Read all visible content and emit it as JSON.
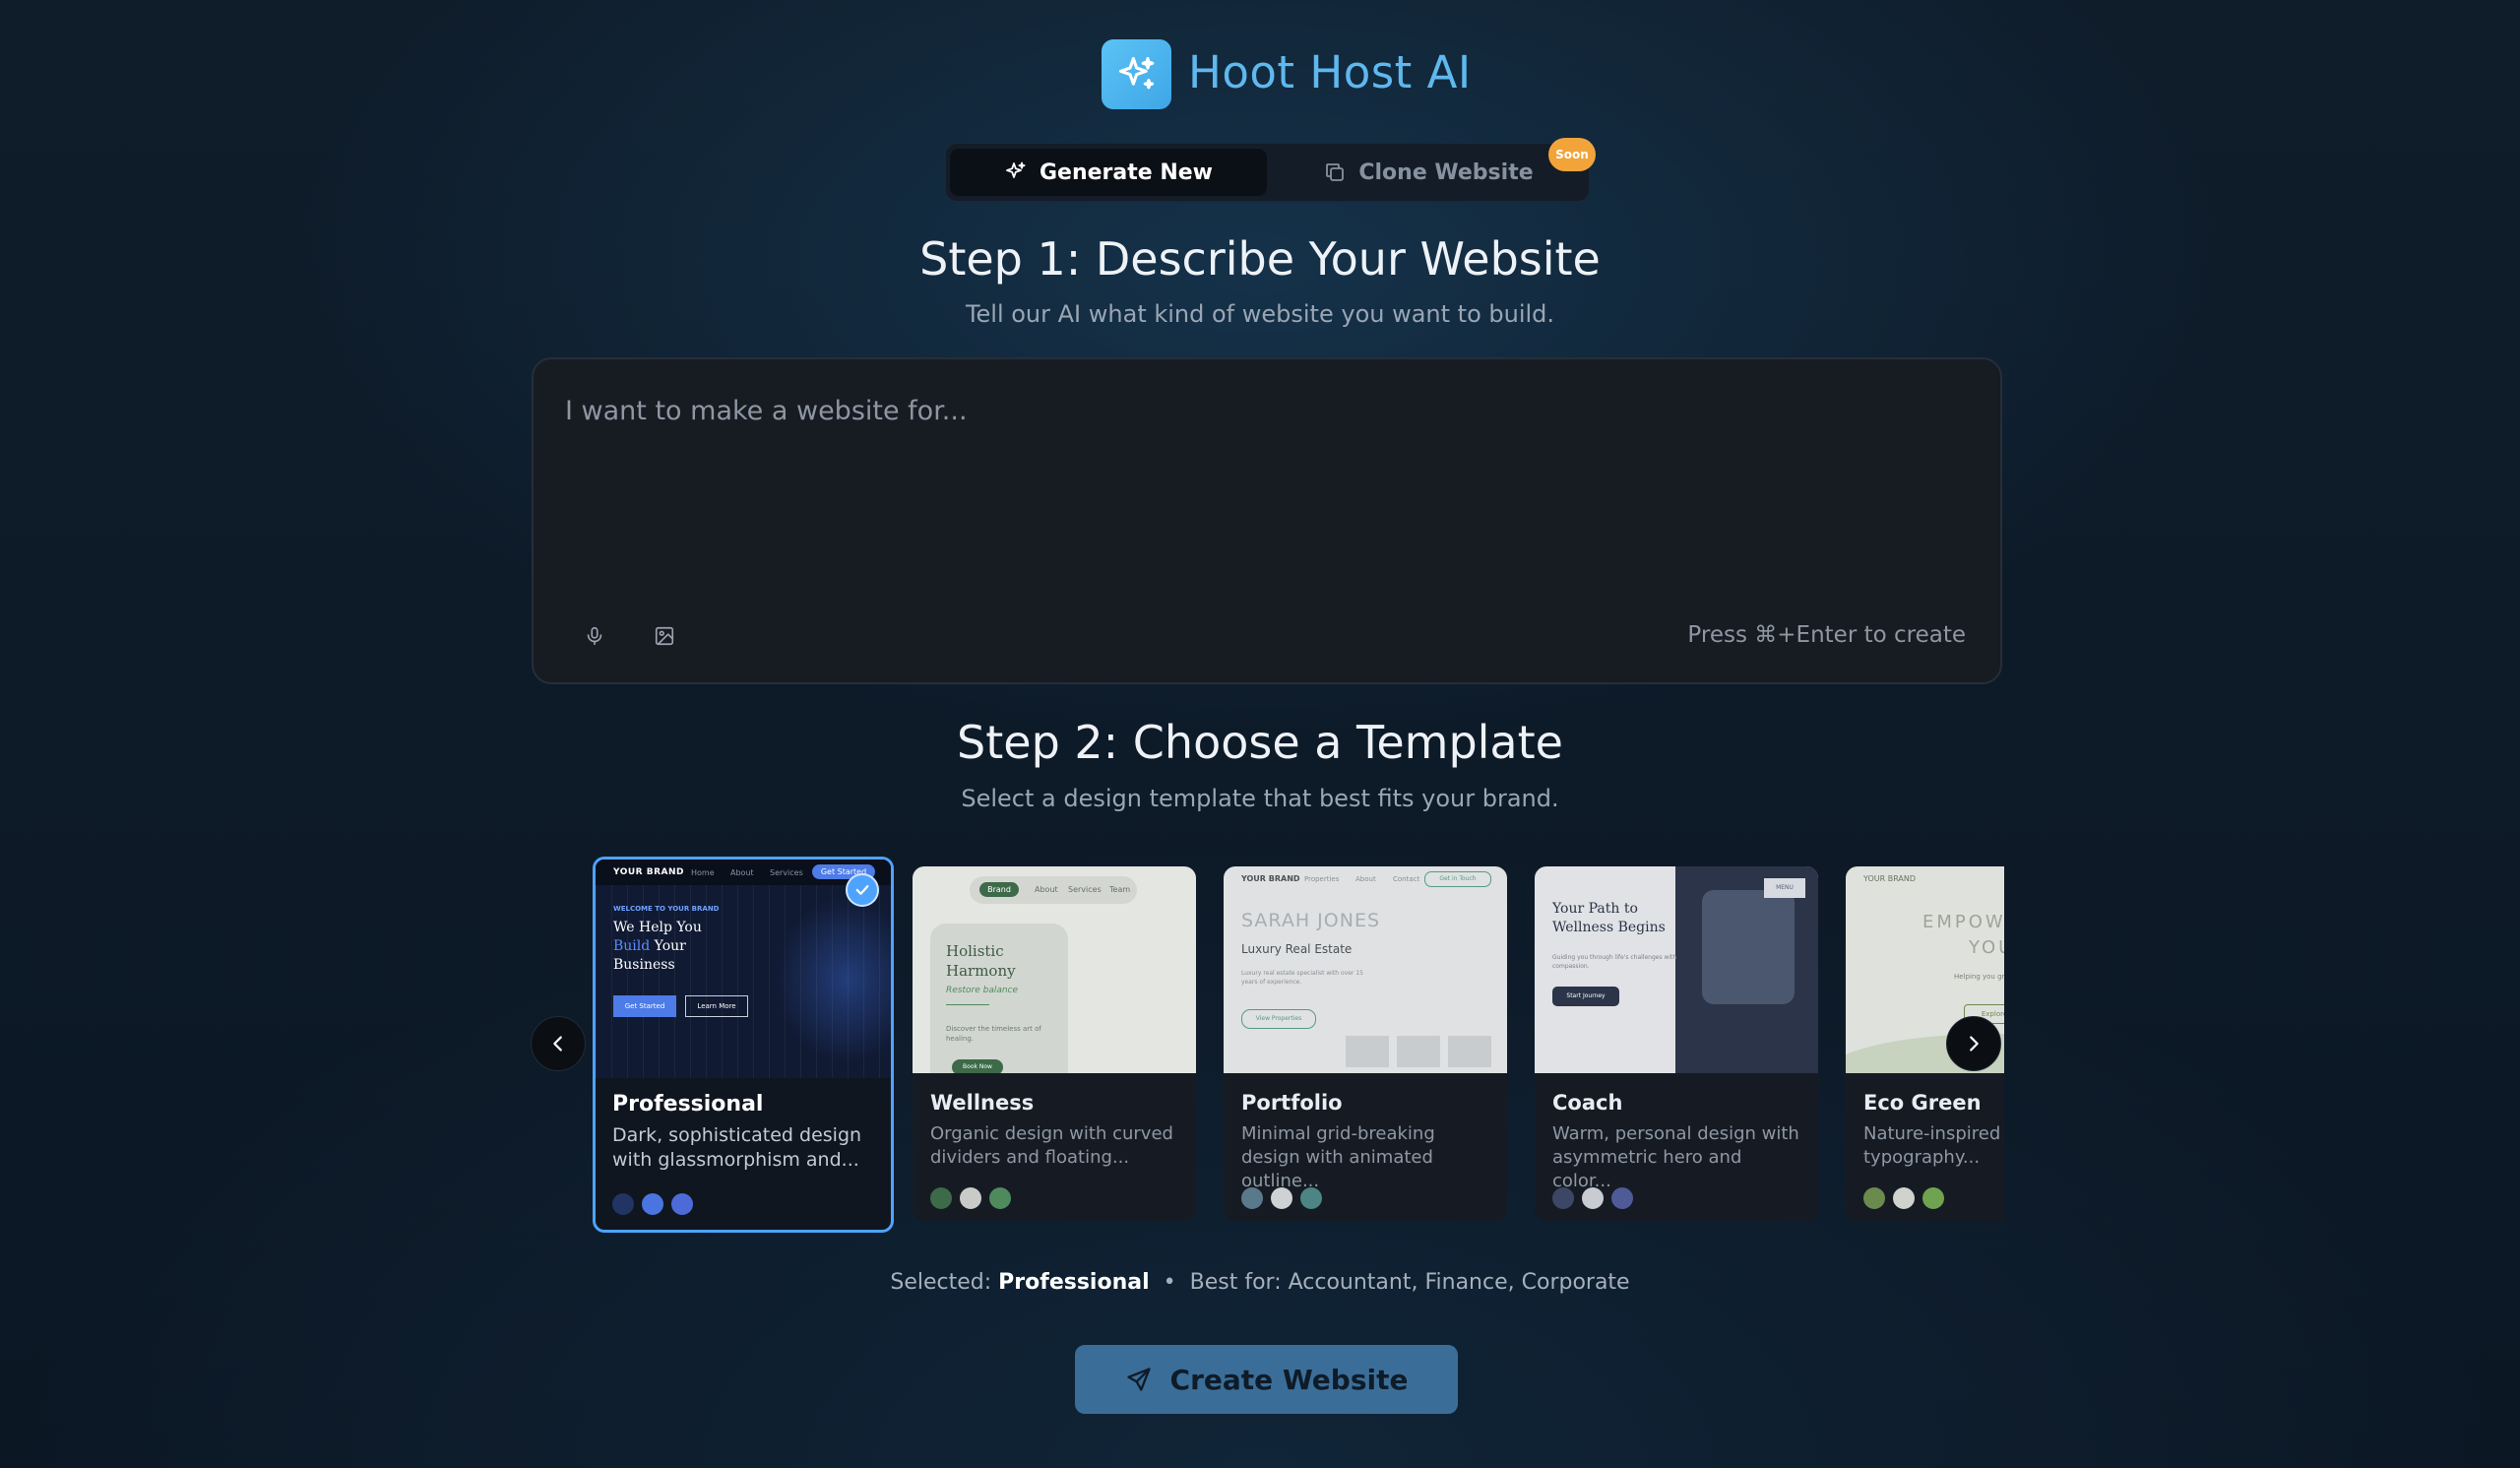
{
  "header": {
    "brand": "Hoot Host AI"
  },
  "tabs": [
    {
      "label": "Generate New",
      "active": true
    },
    {
      "label": "Clone Website",
      "active": false,
      "badge": "Soon"
    }
  ],
  "step1": {
    "title": "Step 1: Describe Your Website",
    "subtitle": "Tell our AI what kind of website you want to build.",
    "placeholder": "I want to make a website for...",
    "hint": "Press ⌘+Enter to create"
  },
  "step2": {
    "title": "Step 2: Choose a Template",
    "subtitle": "Select a design template that best fits your brand."
  },
  "templates": [
    {
      "name": "Professional",
      "description": "Dark, sophisticated design with glassmorphism and...",
      "colors": [
        "#223463",
        "#4a74e0",
        "#4d6bd8"
      ],
      "selected": true,
      "preview": {
        "brand": "YOUR BRAND",
        "nav": [
          "Home",
          "About",
          "Services"
        ],
        "cta": "Get Started",
        "eyebrow": "WELCOME TO YOUR BRAND",
        "headline1": "We Help You",
        "headline2_accent": "Build",
        "headline2_rest": " Your",
        "headline3": "Business",
        "primary": "Get Started",
        "secondary": "Learn More"
      }
    },
    {
      "name": "Wellness",
      "description": "Organic design with curved dividers and floating...",
      "colors": [
        "#3d6a48",
        "#c9cbc9",
        "#4f8a5d"
      ],
      "selected": false,
      "preview": {
        "nav": [
          "Brand",
          "About",
          "Services",
          "Team"
        ],
        "title1": "Holistic",
        "title2": "Harmony",
        "tag": "Restore balance",
        "body": "Discover the timeless art of healing.",
        "cta": "Book Now"
      }
    },
    {
      "name": "Portfolio",
      "description": "Minimal grid-breaking design with animated outline...",
      "colors": [
        "#5a7a8c",
        "#cfd2d4",
        "#4d8584"
      ],
      "selected": false,
      "preview": {
        "brand": "YOUR BRAND",
        "nav": [
          "Properties",
          "About",
          "Contact"
        ],
        "cta": "Get in Touch",
        "name": "SARAH JONES",
        "role": "Luxury Real Estate",
        "body": "Luxury real estate specialist with over 15 years of experience.",
        "button": "View Properties"
      }
    },
    {
      "name": "Coach",
      "description": "Warm, personal design with asymmetric hero and color...",
      "colors": [
        "#3c4766",
        "#c8cbd1",
        "#4f5b98"
      ],
      "selected": false,
      "preview": {
        "title1": "Your Path to",
        "title2": "Wellness Begins",
        "body": "Guiding you through life's challenges with compassion.",
        "button": "Start Journey",
        "menu": "MENU"
      }
    },
    {
      "name": "Eco Green",
      "description": "Nature-inspired with outline typography...",
      "colors": [
        "#6b8a4e",
        "#cfd3cc",
        "#6fa34f"
      ],
      "selected": false,
      "preview": {
        "brand": "YOUR BRAND",
        "title": "EMPOWER",
        "title2": "YOU",
        "body": "Helping you grow and thrive",
        "button": "Explore"
      }
    }
  ],
  "selection": {
    "label": "Selected:",
    "value": "Professional",
    "separator": "•",
    "best_for": "Best for: Accountant, Finance, Corporate"
  },
  "create_button": {
    "label": "Create Website"
  }
}
